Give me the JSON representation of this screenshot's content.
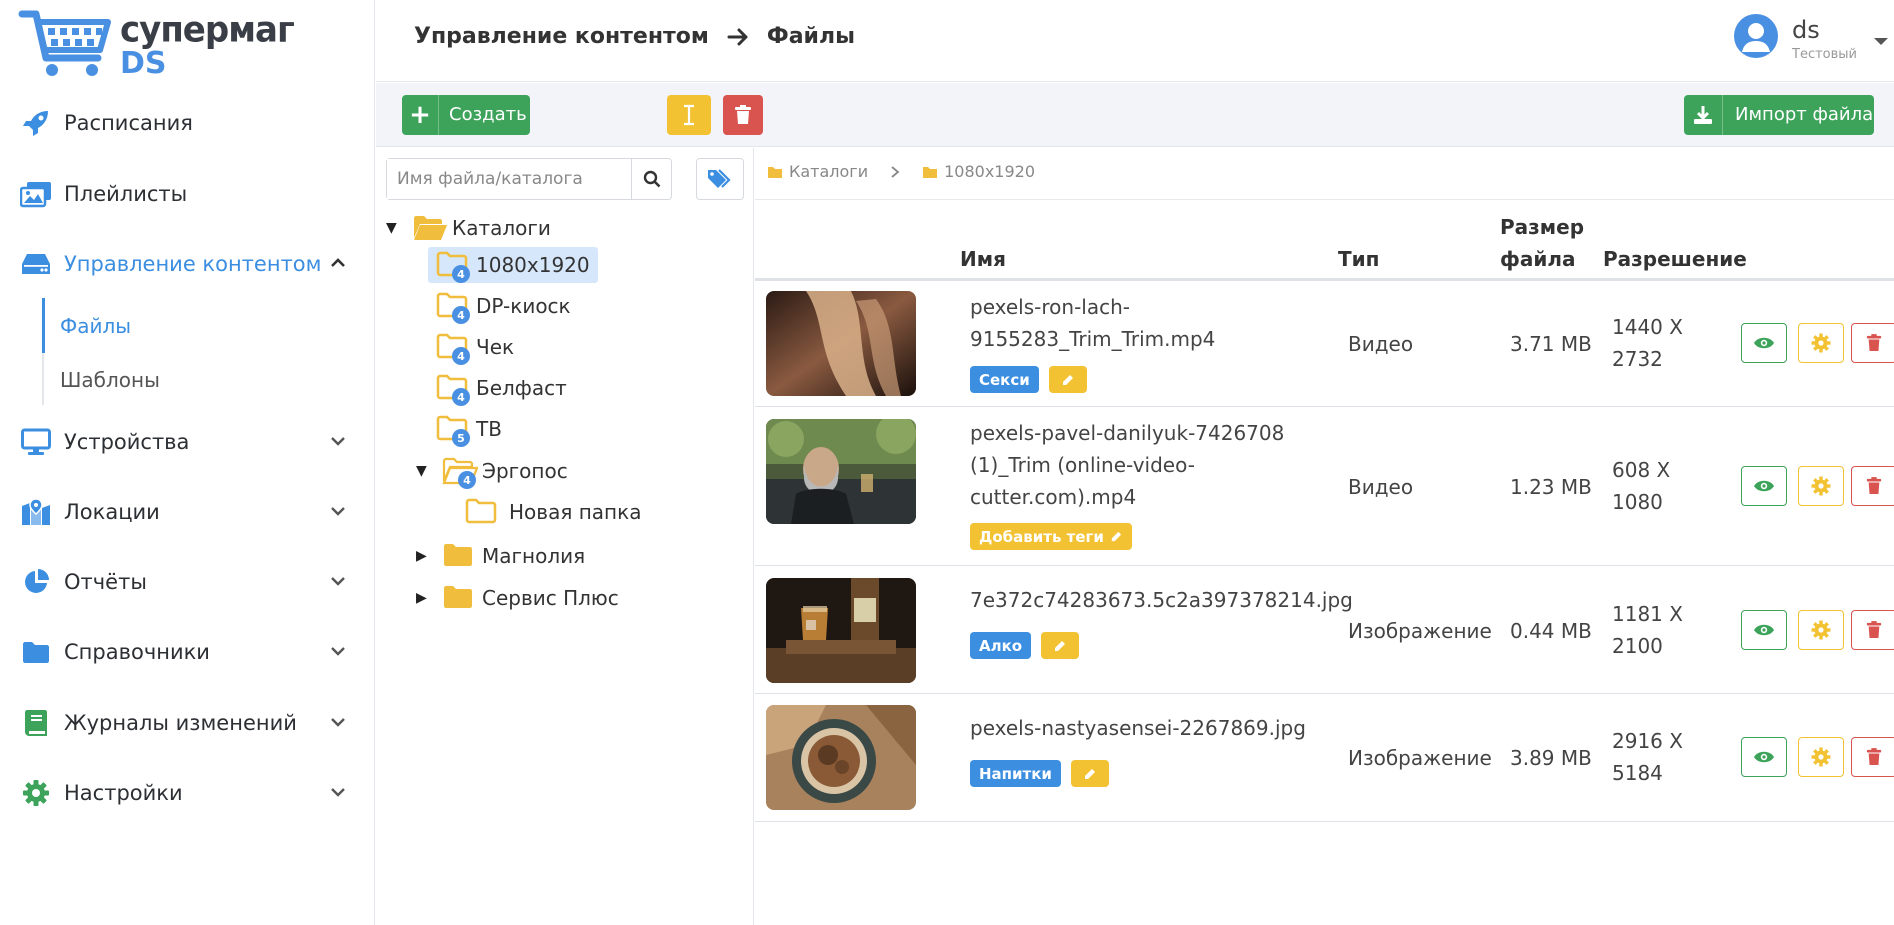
{
  "brand": {
    "line1": "супермаг",
    "line2": "DS"
  },
  "sidebar": {
    "items": [
      {
        "label": "Расписания",
        "icon": "rocket-icon"
      },
      {
        "label": "Плейлисты",
        "icon": "images-icon"
      },
      {
        "label": "Управление контентом",
        "icon": "hdd-icon",
        "expanded": true
      },
      {
        "label": "Устройства",
        "icon": "monitor-icon"
      },
      {
        "label": "Локации",
        "icon": "map-icon"
      },
      {
        "label": "Отчёты",
        "icon": "pie-chart-icon"
      },
      {
        "label": "Справочники",
        "icon": "folder-icon"
      },
      {
        "label": "Журналы изменений",
        "icon": "book-icon"
      },
      {
        "label": "Настройки",
        "icon": "gear-icon"
      }
    ],
    "subitems": [
      {
        "label": "Файлы",
        "active": true
      },
      {
        "label": "Шаблоны",
        "active": false
      }
    ]
  },
  "header": {
    "section": "Управление контентом",
    "page": "Файлы",
    "user": {
      "name": "ds",
      "role": "Тестовый"
    }
  },
  "toolbar": {
    "create_label": "Создать",
    "import_label": "Импорт файла"
  },
  "search": {
    "placeholder": "Имя файла/каталога"
  },
  "tree": {
    "root": "Каталоги",
    "nodes": [
      {
        "label": "1080x1920",
        "count": "4",
        "selected": true
      },
      {
        "label": "DP-киоск",
        "count": "4"
      },
      {
        "label": "Чек",
        "count": "4"
      },
      {
        "label": "Белфаст",
        "count": "4"
      },
      {
        "label": "ТВ",
        "count": "5"
      },
      {
        "label": "Эргопос",
        "count": "4",
        "expanded": true
      },
      {
        "label": "Новая папка"
      },
      {
        "label": "Магнолия",
        "collapsed": true
      },
      {
        "label": "Сервис Плюс",
        "collapsed": true
      }
    ]
  },
  "crumbs": [
    "Каталоги",
    "1080x1920"
  ],
  "table": {
    "headers": {
      "name": "Имя",
      "type": "Тип",
      "size_line1": "Размер",
      "size_line2": "файла",
      "resolution": "Разрешение"
    },
    "rows": [
      {
        "name_lines": [
          "pexels-ron-lach-",
          "9155283_Trim_Trim.mp4"
        ],
        "type": "Видео",
        "size": "3.71 MB",
        "res1": "1440 X",
        "res2": "2732",
        "tag": "Секси",
        "tag_color": "#3b8ee0"
      },
      {
        "name_lines": [
          "pexels-pavel-danilyuk-7426708",
          "(1)_Trim (online-video-",
          "cutter.com).mp4"
        ],
        "type": "Видео",
        "size": "1.23 MB",
        "res1": "608 X",
        "res2": "1080",
        "tag": "Добавить теги",
        "tag_color": "#f2c233"
      },
      {
        "name_lines": [
          "7e372c74283673.5c2a397378214.jpg"
        ],
        "type": "Изображение",
        "size": "0.44 MB",
        "res1": "1181 X",
        "res2": "2100",
        "tag": "Алко",
        "tag_color": "#3b8ee0"
      },
      {
        "name_lines": [
          "pexels-nastyasensei-2267869.jpg"
        ],
        "type": "Изображение",
        "size": "3.89 MB",
        "res1": "2916 X",
        "res2": "5184",
        "tag": "Напитки",
        "tag_color": "#3b8ee0"
      }
    ]
  },
  "colors": {
    "accent": "#3b8ee0",
    "success": "#3da35a",
    "warning": "#f2c233",
    "danger": "#d9534f",
    "folder": "#f0bd3c"
  }
}
